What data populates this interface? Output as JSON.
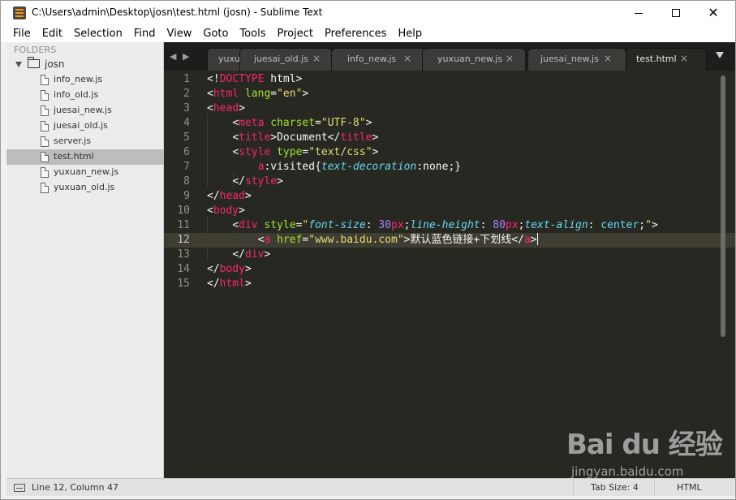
{
  "window": {
    "title": "C:\\Users\\admin\\Desktop\\josn\\test.html (josn) - Sublime Text",
    "minimize_glyph": "",
    "close_glyph": "✕"
  },
  "menu": [
    "File",
    "Edit",
    "Selection",
    "Find",
    "View",
    "Goto",
    "Tools",
    "Project",
    "Preferences",
    "Help"
  ],
  "sidebar": {
    "header": "FOLDERS",
    "folder": "josn",
    "files": [
      "info_new.js",
      "info_old.js",
      "juesai_new.js",
      "juesai_old.js",
      "server.js",
      "test.html",
      "yuxuan_new.js",
      "yuxuan_old.js"
    ],
    "selected_file": "test.html"
  },
  "tabs": {
    "nav_left": "◀",
    "nav_right": "▶",
    "items": [
      {
        "label": "yuxuan_old.js",
        "close": "×"
      },
      {
        "label": "juesai_old.js",
        "close": "×"
      },
      {
        "label": "info_new.js",
        "close": "×"
      },
      {
        "label": "yuxuan_new.js",
        "close": "×"
      },
      {
        "label": "juesai_new.js",
        "close": "×"
      },
      {
        "label": "test.html",
        "close": "×"
      }
    ],
    "active": "test.html"
  },
  "editor": {
    "line_numbers": [
      "1",
      "2",
      "3",
      "4",
      "5",
      "6",
      "7",
      "8",
      "9",
      "10",
      "11",
      "12",
      "13",
      "14",
      "15"
    ],
    "current_line": "12",
    "lines": [
      "<!DOCTYPE html>",
      "<html lang=\"en\">",
      "<head>",
      "    <meta charset=\"UTF-8\">",
      "    <title>Document</title>",
      "    <style type=\"text/css\">",
      "        a:visited{text-decoration:none;}",
      "    </style>",
      "</head>",
      "<body>",
      "    <div style=\"font-size: 30px;line-height: 80px;text-align: center;\">",
      "        <a href=\"www.baidu.com\">默认蓝色链接+下划线</a>",
      "    </div>",
      "</body>",
      "</html>"
    ],
    "colors": {
      "background": "#272822",
      "tag": "#f92672",
      "attribute": "#a6e22e",
      "string": "#e6db74",
      "property": "#66d9ef",
      "number": "#ae81ff",
      "text": "#f8f8f2"
    }
  },
  "status": {
    "position": "Line 12, Column 47",
    "tab_size": "Tab Size: 4",
    "syntax": "HTML"
  },
  "watermark": {
    "logo": "Bai du 经验",
    "url": "jingyan.baidu.com"
  }
}
